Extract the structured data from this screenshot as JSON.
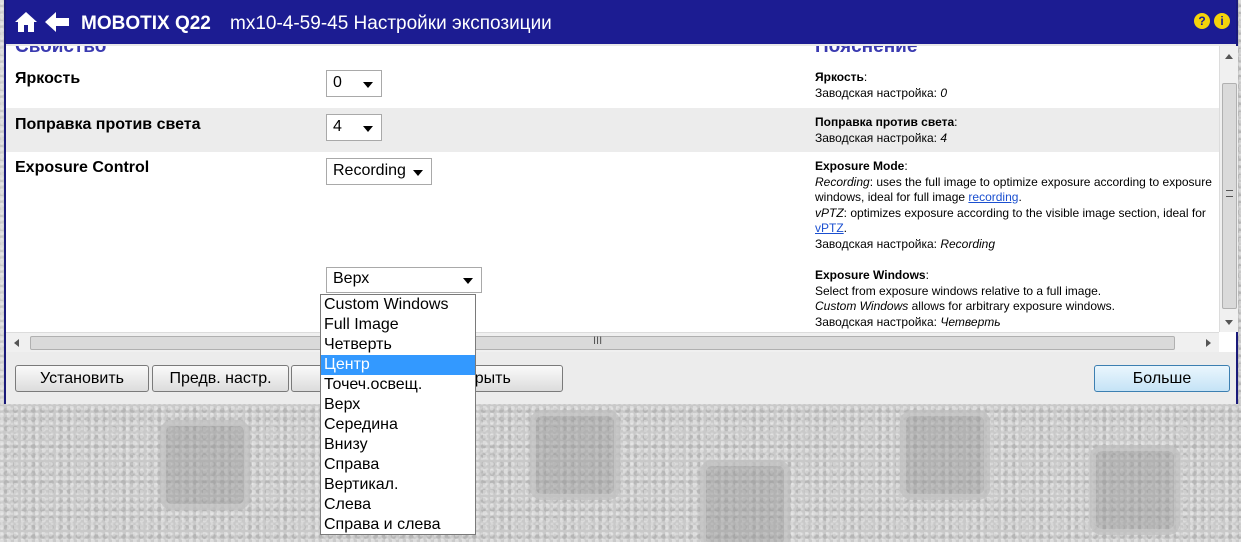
{
  "titlebar": {
    "brand": "MOBOTIX Q22",
    "title": "mx10-4-59-45 Настройки экспозиции",
    "help_icon": "question-icon",
    "info_icon": "info-icon"
  },
  "columns": {
    "property": "Свойство",
    "explanation": "Пояснение"
  },
  "rows": [
    {
      "label": "Яркость",
      "value": "0",
      "expl_title": "Яркость",
      "expl_default_label": "Заводская настройка:",
      "expl_default_value": "0"
    },
    {
      "label": "Поправка против света",
      "value": "4",
      "expl_title": "Поправка против света",
      "expl_default_label": "Заводская настройка:",
      "expl_default_value": "4"
    },
    {
      "label": "Exposure Control",
      "value": "Recording",
      "expl_title": "Exposure Mode",
      "expl_rec_term": "Recording",
      "expl_rec_text_1": ": uses the full image to optimize exposure according to exposure windows, ideal for full image ",
      "expl_rec_link": "recording",
      "expl_vptz_term": "vPTZ",
      "expl_vptz_text": ": optimizes exposure according to the visible image section, ideal for ",
      "expl_vptz_link": "vPTZ",
      "expl_default_label": "Заводская настройка:",
      "expl_default_value": "Recording"
    }
  ],
  "windows_row": {
    "value": "Верх",
    "expl_title": "Exposure Windows",
    "expl_line1": "Select from exposure windows relative to a full image.",
    "expl_custom_term": "Custom Windows",
    "expl_custom_text": " allows for arbitrary exposure windows.",
    "expl_default_label": "Заводская настройка:",
    "expl_default_value": "Четверть"
  },
  "dropdown": {
    "options": [
      "Custom Windows",
      "Full Image",
      "Четверть",
      "Центр",
      "Точеч.освещ.",
      "Верх",
      "Середина",
      "Внизу",
      "Справа",
      "Вертикал.",
      "Слева",
      "Справа и слева"
    ],
    "highlighted": "Центр"
  },
  "footer": {
    "set_label": "Установить",
    "preset_label": "Предв. настр.",
    "close_label": "Закрыть",
    "more_label": "Больше"
  },
  "scrollbar": {
    "grip": "III"
  }
}
